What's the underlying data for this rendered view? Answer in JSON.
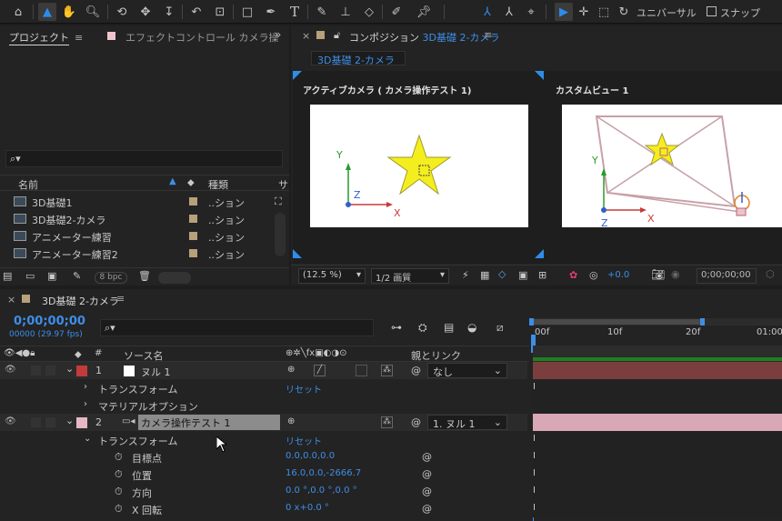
{
  "toolbar": {
    "universal_label": "ユニバーサル",
    "snap_label": "スナップ"
  },
  "project": {
    "tab_project": "プロジェクト",
    "tab_effect": "エフェクトコントロール カメラ操",
    "search_placeholder": "",
    "col_name": "名前",
    "col_type": "種類",
    "col_size": "サ",
    "items": [
      {
        "name": "3D基礎1",
        "type": "..ション"
      },
      {
        "name": "3D基礎2-カメラ",
        "type": "..ション"
      },
      {
        "name": "アニメーター練習",
        "type": "..ション"
      },
      {
        "name": "アニメーター練習2",
        "type": "..ション"
      }
    ],
    "bpc": "8 bpc"
  },
  "composition": {
    "tab_title": "コンポジション",
    "tab_comp_name": "3D基礎 2-カメラ",
    "breadcrumb": "3D基礎 2-カメラ",
    "view_left_title": "アクティブカメラ ( カメラ操作テスト 1)",
    "view_right_title": "カスタムビュー 1",
    "zoom": "(12.5 %)",
    "resolution": "1/2 画質",
    "exposure": "+0.0",
    "timecode": "0;00;00;00",
    "axis_x": "X",
    "axis_y": "Y",
    "axis_z": "Z"
  },
  "timeline": {
    "tab_title": "3D基礎 2-カメラ",
    "timecode": "0;00;00;00",
    "subcode": "00000 (29.97 fps)",
    "col_num": "#",
    "col_source": "ソース名",
    "col_parent": "親とリンク",
    "ruler": [
      "00f",
      "10f",
      "20f",
      "01:00"
    ],
    "layers": [
      {
        "num": "1",
        "name": "ヌル 1",
        "parent": "なし",
        "color": "#c43a3a"
      },
      {
        "num": "2",
        "name": "カメラ操作テスト 1",
        "parent": "1. ヌル 1",
        "color": "#e6b8c4"
      }
    ],
    "rows": {
      "transform1": "トランスフォーム",
      "reset1": "リセット",
      "material": "マテリアルオプション",
      "transform2": "トランスフォーム",
      "reset2": "リセット",
      "poi_label": "目標点",
      "poi_value": "0.0,0.0,0.0",
      "pos_label": "位置",
      "pos_value": "16.0,0.0,-2666.7",
      "ori_label": "方向",
      "ori_value": "0.0 °,0.0 °,0.0 °",
      "xrot_label": "X 回転",
      "xrot_value": "0 x+0.0 °"
    }
  }
}
